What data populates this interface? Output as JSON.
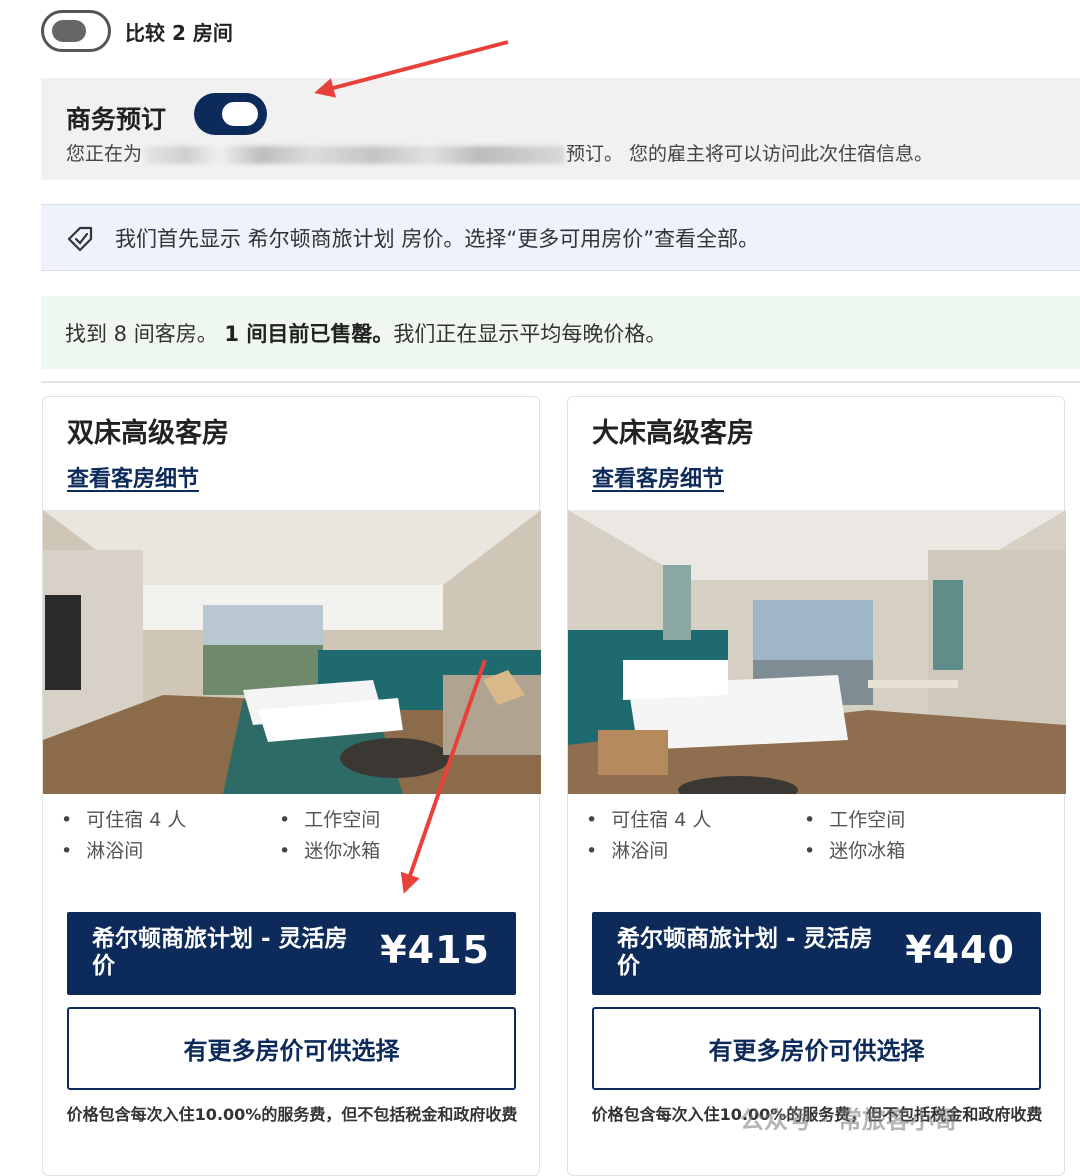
{
  "compare": {
    "label": "比较 2 房间"
  },
  "business": {
    "title": "商务预订",
    "desc_prefix": "您正在为",
    "desc_suffix": "预订。 您的雇主将可以访问此次住宿信息。"
  },
  "info_banner": {
    "text": "我们首先显示 希尔顿商旅计划 房价。选择“更多可用房价”查看全部。"
  },
  "found_banner": {
    "text_a": "找到 8 间客房。",
    "text_b": "1 间目前已售罄。",
    "text_c": "我们正在显示平均每晚价格。"
  },
  "rooms": [
    {
      "name": "双床高级客房",
      "link": "查看客房细节",
      "amenities": [
        "可住宿 4 人",
        "工作空间",
        "淋浴间",
        "迷你冰箱"
      ],
      "rate_name": "希尔顿商旅计划 - 灵活房价",
      "price": "¥415",
      "more": "有更多房价可供选择",
      "note": "价格包含每次入住10.00%的服务费，但不包括税金和政府收费"
    },
    {
      "name": "大床高级客房",
      "link": "查看客房细节",
      "amenities": [
        "可住宿 4 人",
        "工作空间",
        "淋浴间",
        "迷你冰箱"
      ],
      "rate_name": "希尔顿商旅计划 - 灵活房价",
      "price": "¥440",
      "more": "有更多房价可供选择",
      "note": "价格包含每次入住10.00%的服务费，但不包括税金和政府收费"
    }
  ],
  "watermark": "公众号 · 常旅客小哥",
  "colors": {
    "brand_navy": "#0c2a5a",
    "arrow_red": "#e8413a"
  }
}
